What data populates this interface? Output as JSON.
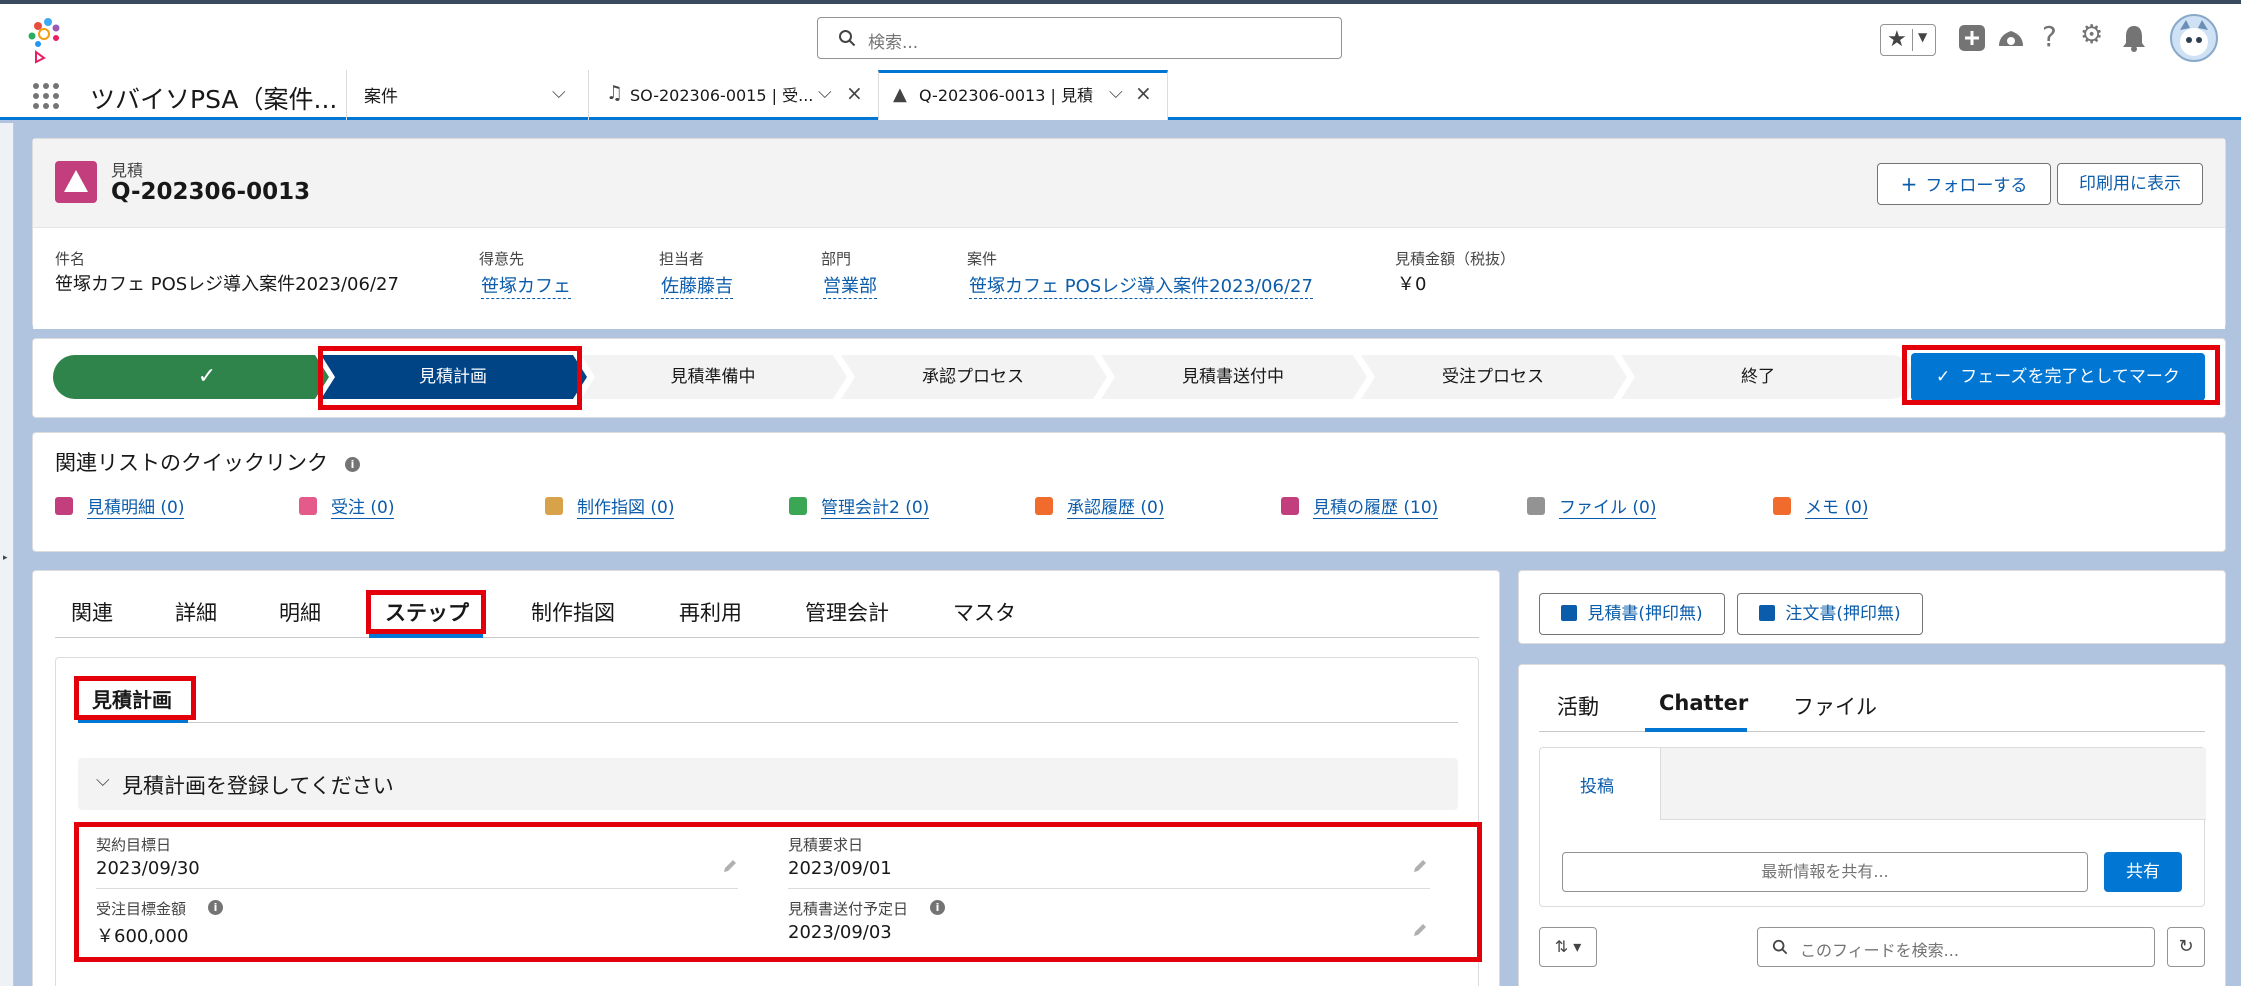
{
  "header": {
    "search_placeholder": "検索..."
  },
  "nav": {
    "app_name": "ツバイソPSA（案件...",
    "object_tab": "案件",
    "tab1_label": "SO-202306-0015 | 受...",
    "tab2_label": "Q-202306-0013 | 見積"
  },
  "record": {
    "object_label": "見積",
    "title": "Q-202306-0013",
    "follow_label": "フォローする",
    "print_label": "印刷用に表示",
    "fields": [
      {
        "label": "件名",
        "value": "笹塚カフェ POSレジ導入案件2023/06/27"
      },
      {
        "label": "得意先",
        "value": "笹塚カフェ"
      },
      {
        "label": "担当者",
        "value": "佐藤藤吉"
      },
      {
        "label": "部門",
        "value": "営業部"
      },
      {
        "label": "案件",
        "value": "笹塚カフェ POSレジ導入案件2023/06/27"
      },
      {
        "label": "見積金額（税抜）",
        "value": "￥0"
      }
    ]
  },
  "path": {
    "stages": [
      "見積計画",
      "見積準備中",
      "承認プロセス",
      "見積書送付中",
      "受注プロセス",
      "終了"
    ],
    "mark_complete": "フェーズを完了としてマーク"
  },
  "quicklinks": {
    "title": "関連リストのクイックリンク",
    "items": [
      {
        "label": "見積明細 (0)",
        "color": "#c23e7c"
      },
      {
        "label": "受注 (0)",
        "color": "#e35a8b"
      },
      {
        "label": "制作指図 (0)",
        "color": "#d8a24a"
      },
      {
        "label": "管理会計2 (0)",
        "color": "#3ba755"
      },
      {
        "label": "承認履歴 (0)",
        "color": "#f06b2c"
      },
      {
        "label": "見積の履歴 (10)",
        "color": "#c23e7c"
      },
      {
        "label": "ファイル (0)",
        "color": "#939393"
      },
      {
        "label": "メモ (0)",
        "color": "#f06b2c"
      }
    ]
  },
  "tabs": [
    "関連",
    "詳細",
    "明細",
    "ステップ",
    "制作指図",
    "再利用",
    "管理会計",
    "マスタ"
  ],
  "step": {
    "subtab": "見積計画",
    "section_title": "見積計画を登録してください",
    "fields": [
      {
        "label": "契約目標日",
        "value": "2023/09/30"
      },
      {
        "label": "見積要求日",
        "value": "2023/09/01"
      },
      {
        "label": "受注目標金額",
        "value": "￥600,000"
      },
      {
        "label": "見積書送付予定日",
        "value": "2023/09/03"
      }
    ]
  },
  "side": {
    "btn1": "見積書(押印無)",
    "btn2": "注文書(押印無)",
    "tabs": [
      "活動",
      "Chatter",
      "ファイル"
    ],
    "post_tab": "投稿",
    "share_placeholder": "最新情報を共有...",
    "share_button": "共有",
    "feed_search_placeholder": "このフィードを検索..."
  }
}
